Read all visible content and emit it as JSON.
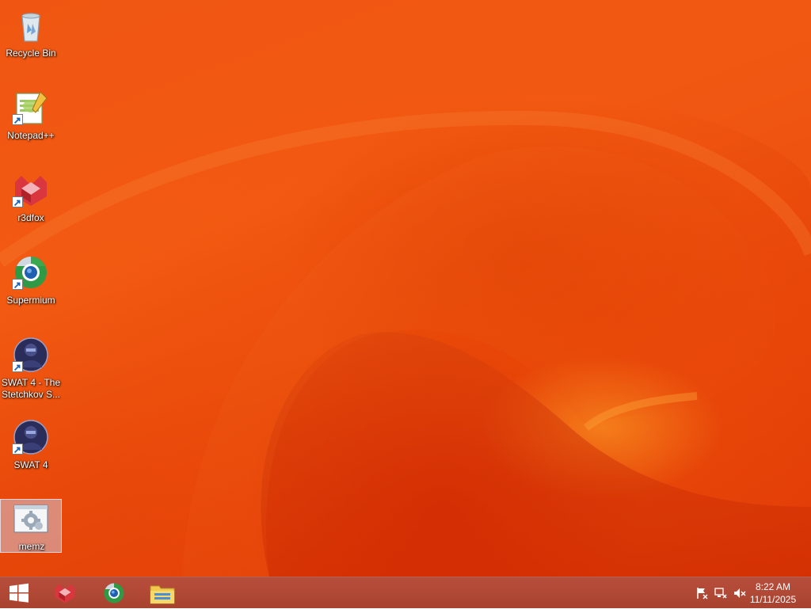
{
  "desktop": {
    "icons": [
      {
        "label": "Recycle Bin",
        "icon": "recycle-bin-icon",
        "shortcut": false
      },
      {
        "label": "Notepad++",
        "icon": "notepad-plus-plus-icon",
        "shortcut": true
      },
      {
        "label": "r3dfox",
        "icon": "r3dfox-icon",
        "shortcut": true
      },
      {
        "label": "Supermium",
        "icon": "supermium-icon",
        "shortcut": true
      },
      {
        "label": "SWAT 4 - The\nStetchkov S...",
        "icon": "swat4-stetchkov-icon",
        "shortcut": true
      },
      {
        "label": "SWAT 4",
        "icon": "swat4-icon",
        "shortcut": true
      },
      {
        "label": "memz",
        "icon": "memz-icon",
        "shortcut": false,
        "selected": true
      }
    ]
  },
  "taskbar": {
    "start": {
      "icon": "windows-start-icon"
    },
    "pinned": [
      {
        "icon": "r3dfox-icon"
      },
      {
        "icon": "supermium-icon"
      },
      {
        "icon": "file-explorer-icon"
      }
    ],
    "tray": {
      "icons": [
        "action-center-flag-icon",
        "network-icon",
        "volume-muted-icon"
      ],
      "time": "8:22 AM",
      "date": "11/11/2025"
    }
  },
  "colors": {
    "wallpaper": "#f0530f",
    "taskbar": "#b04a36"
  }
}
